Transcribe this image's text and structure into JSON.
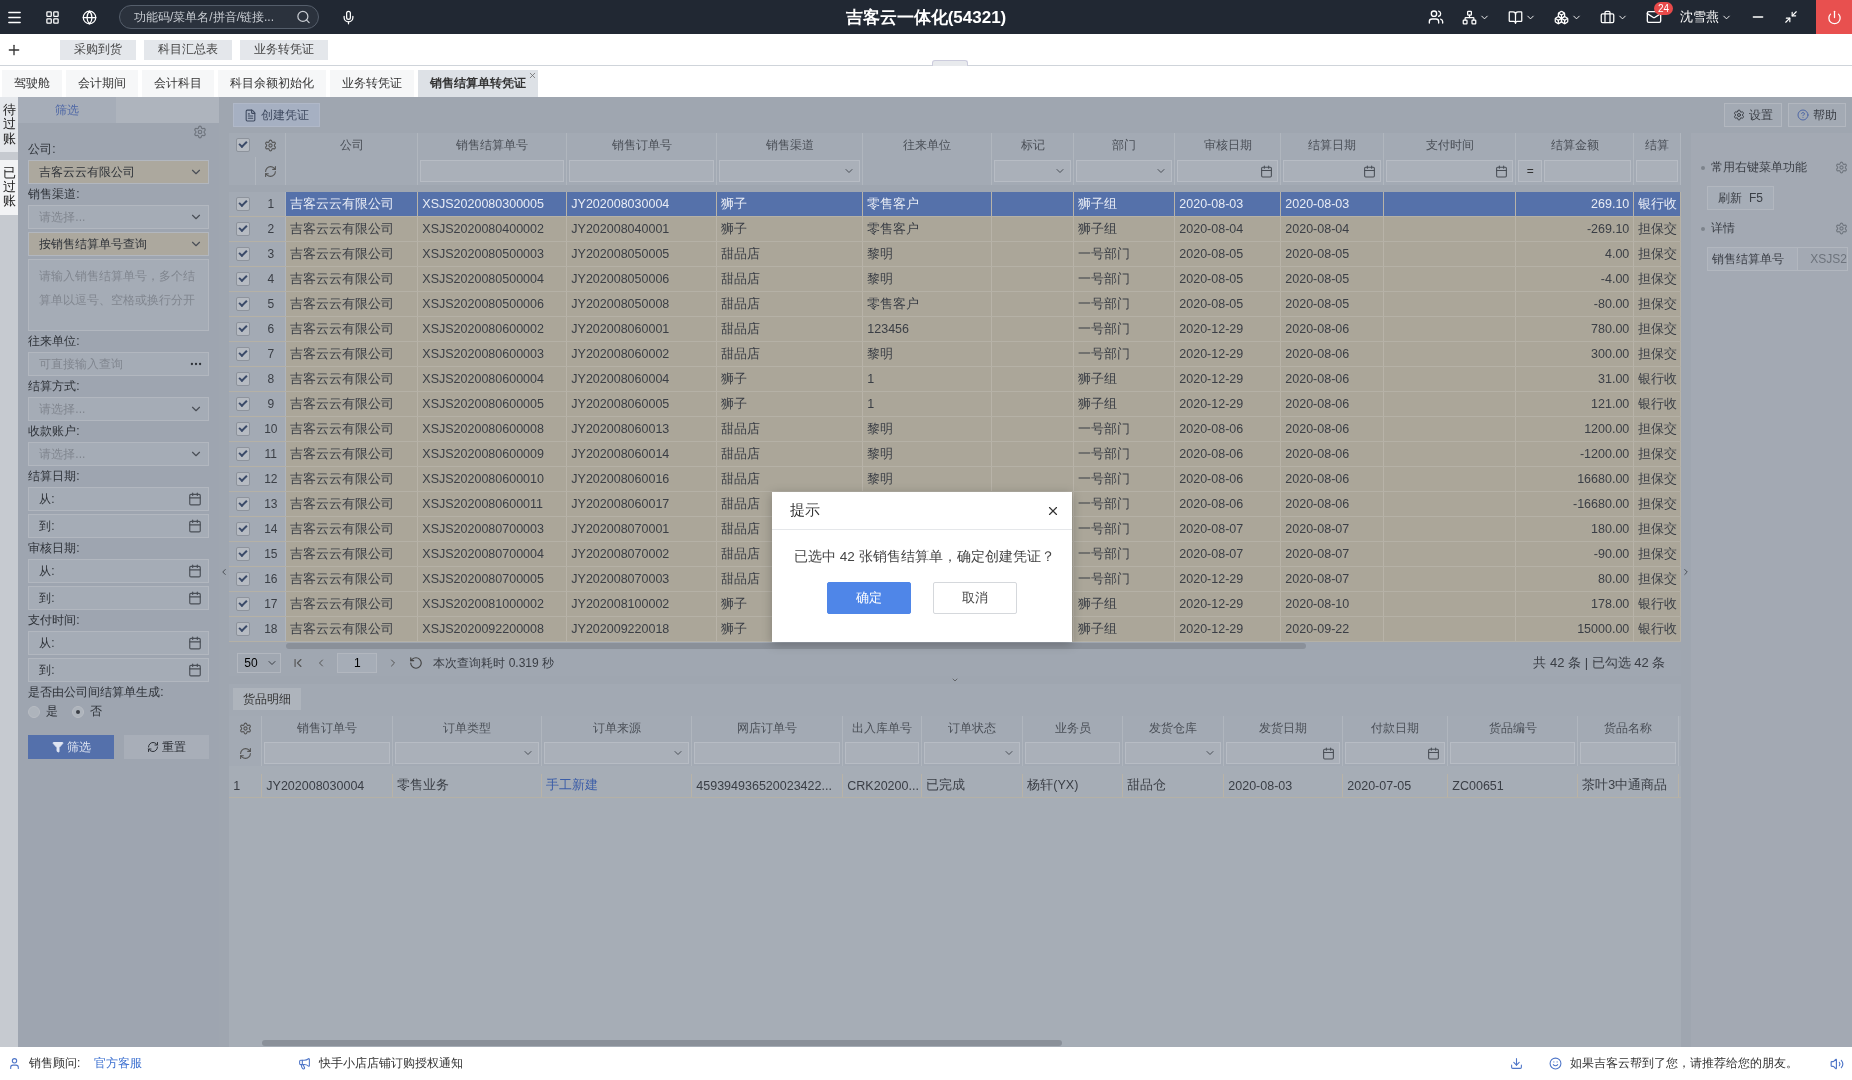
{
  "top_bar": {
    "search": {
      "placeholder": "功能码/菜单名/拼音/链接..."
    },
    "title": "吉客云一体化(54321)",
    "mail_badge": "24",
    "user": "沈雪燕"
  },
  "quick_bar": {
    "chips": [
      "采购到货",
      "科目汇总表",
      "业务转凭证"
    ]
  },
  "tabs": [
    {
      "label": "驾驶舱",
      "selected": false
    },
    {
      "label": "会计期间",
      "selected": false
    },
    {
      "label": "会计科目",
      "selected": false
    },
    {
      "label": "科目余额初始化",
      "selected": false
    },
    {
      "label": "业务转凭证",
      "selected": false
    },
    {
      "label": "销售结算单转凭证",
      "selected": true
    }
  ],
  "side_tabs": [
    {
      "label": "待过账",
      "selected": true
    },
    {
      "label": "已过账",
      "selected": false
    }
  ],
  "filter_panel": {
    "tabs": [
      {
        "label": "筛选",
        "selected": true
      }
    ],
    "fields": [
      {
        "kind": "select",
        "label": "公司:",
        "value": "吉客云云有限公司"
      },
      {
        "kind": "select",
        "label": "销售渠道:",
        "placeholder": "请选择..."
      },
      {
        "kind": "select",
        "value": "按销售结算单号查询"
      },
      {
        "kind": "textarea",
        "placeholder": "请输入销售结算单号，多个结算单以逗号、空格或换行分开"
      },
      {
        "kind": "lookup",
        "label": "往来单位:",
        "placeholder": "可直接输入查询"
      },
      {
        "kind": "select",
        "label": "结算方式:",
        "placeholder": "请选择..."
      },
      {
        "kind": "select",
        "label": "收款账户:",
        "placeholder": "请选择..."
      },
      {
        "kind": "date_range",
        "label": "结算日期:",
        "from": "从:",
        "to": "到:"
      },
      {
        "kind": "date_range",
        "label": "审核日期:",
        "from": "从:",
        "to": "到:"
      },
      {
        "kind": "date_range",
        "label": "支付时间:",
        "from": "从:",
        "to": "到:"
      },
      {
        "kind": "radio",
        "label": "是否由公司间结算单生成:",
        "options": [
          {
            "label": "是",
            "selected": false
          },
          {
            "label": "否",
            "selected": true
          }
        ]
      }
    ],
    "buttons": [
      {
        "label": "筛选",
        "kind": "primary"
      },
      {
        "label": "重置",
        "kind": "secondary"
      }
    ]
  },
  "toolbar": {
    "create_button": "创建凭证",
    "settings": "设置",
    "help": "帮助"
  },
  "table": {
    "header_checked": true,
    "columns": [
      {
        "label": "公司",
        "kind": "plain"
      },
      {
        "label": "销售结算单号",
        "kind": "text"
      },
      {
        "label": "销售订单号",
        "kind": "text"
      },
      {
        "label": "销售渠道",
        "kind": "select"
      },
      {
        "label": "往来单位",
        "kind": "plain"
      },
      {
        "label": "标记",
        "kind": "select"
      },
      {
        "label": "部门",
        "kind": "select"
      },
      {
        "label": "审核日期",
        "kind": "date"
      },
      {
        "label": "结算日期",
        "kind": "date"
      },
      {
        "label": "支付时间",
        "kind": "date"
      },
      {
        "label": "结算金额",
        "kind": "equals",
        "operator": "="
      },
      {
        "label": "结算",
        "kind": "text"
      }
    ],
    "rows": [
      {
        "no": "1",
        "checked": true,
        "selected": true,
        "cells": [
          "吉客云云有限公司",
          "XSJS2020080300005",
          "JY202008030004",
          "狮子",
          "零售客户",
          null,
          "狮子组",
          "2020-08-03",
          "2020-08-03",
          null,
          "269.10",
          "银行收"
        ]
      },
      {
        "no": "2",
        "checked": true,
        "selected": false,
        "cells": [
          "吉客云云有限公司",
          "XSJS2020080400002",
          "JY202008040001",
          "狮子",
          "零售客户",
          null,
          "狮子组",
          "2020-08-04",
          "2020-08-04",
          null,
          "-269.10",
          "担保交"
        ]
      },
      {
        "no": "3",
        "checked": true,
        "selected": false,
        "cells": [
          "吉客云云有限公司",
          "XSJS2020080500003",
          "JY202008050005",
          "甜品店",
          "黎明",
          null,
          "一号部门",
          "2020-08-05",
          "2020-08-05",
          null,
          "4.00",
          "担保交"
        ]
      },
      {
        "no": "4",
        "checked": true,
        "selected": false,
        "cells": [
          "吉客云云有限公司",
          "XSJS2020080500004",
          "JY202008050006",
          "甜品店",
          "黎明",
          null,
          "一号部门",
          "2020-08-05",
          "2020-08-05",
          null,
          "-4.00",
          "担保交"
        ]
      },
      {
        "no": "5",
        "checked": true,
        "selected": false,
        "cells": [
          "吉客云云有限公司",
          "XSJS2020080500006",
          "JY202008050008",
          "甜品店",
          "零售客户",
          null,
          "一号部门",
          "2020-08-05",
          "2020-08-05",
          null,
          "-80.00",
          "担保交"
        ]
      },
      {
        "no": "6",
        "checked": true,
        "selected": false,
        "cells": [
          "吉客云云有限公司",
          "XSJS2020080600002",
          "JY202008060001",
          "甜品店",
          "123456",
          null,
          "一号部门",
          "2020-12-29",
          "2020-08-06",
          null,
          "780.00",
          "担保交"
        ]
      },
      {
        "no": "7",
        "checked": true,
        "selected": false,
        "cells": [
          "吉客云云有限公司",
          "XSJS2020080600003",
          "JY202008060002",
          "甜品店",
          "黎明",
          null,
          "一号部门",
          "2020-12-29",
          "2020-08-06",
          null,
          "300.00",
          "担保交"
        ]
      },
      {
        "no": "8",
        "checked": true,
        "selected": false,
        "cells": [
          "吉客云云有限公司",
          "XSJS2020080600004",
          "JY202008060004",
          "狮子",
          "1",
          null,
          "狮子组",
          "2020-12-29",
          "2020-08-06",
          null,
          "31.00",
          "银行收"
        ]
      },
      {
        "no": "9",
        "checked": true,
        "selected": false,
        "cells": [
          "吉客云云有限公司",
          "XSJS2020080600005",
          "JY202008060005",
          "狮子",
          "1",
          null,
          "狮子组",
          "2020-12-29",
          "2020-08-06",
          null,
          "121.00",
          "银行收"
        ]
      },
      {
        "no": "10",
        "checked": true,
        "selected": false,
        "cells": [
          "吉客云云有限公司",
          "XSJS2020080600008",
          "JY202008060013",
          "甜品店",
          "黎明",
          null,
          "一号部门",
          "2020-08-06",
          "2020-08-06",
          null,
          "1200.00",
          "担保交"
        ]
      },
      {
        "no": "11",
        "checked": true,
        "selected": false,
        "cells": [
          "吉客云云有限公司",
          "XSJS2020080600009",
          "JY202008060014",
          "甜品店",
          "黎明",
          null,
          "一号部门",
          "2020-08-06",
          "2020-08-06",
          null,
          "-1200.00",
          "担保交"
        ]
      },
      {
        "no": "12",
        "checked": true,
        "selected": false,
        "cells": [
          "吉客云云有限公司",
          "XSJS2020080600010",
          "JY202008060016",
          "甜品店",
          "黎明",
          null,
          "一号部门",
          "2020-08-06",
          "2020-08-06",
          null,
          "16680.00",
          "担保交"
        ]
      },
      {
        "no": "13",
        "checked": true,
        "selected": false,
        "cells": [
          "吉客云云有限公司",
          "XSJS2020080600011",
          "JY202008060017",
          "甜品店",
          null,
          null,
          "一号部门",
          "2020-08-06",
          "2020-08-06",
          null,
          "-16680.00",
          "担保交"
        ]
      },
      {
        "no": "14",
        "checked": true,
        "selected": false,
        "cells": [
          "吉客云云有限公司",
          "XSJS2020080700003",
          "JY202008070001",
          "甜品店",
          null,
          null,
          "一号部门",
          "2020-08-07",
          "2020-08-07",
          null,
          "180.00",
          "担保交"
        ]
      },
      {
        "no": "15",
        "checked": true,
        "selected": false,
        "cells": [
          "吉客云云有限公司",
          "XSJS2020080700004",
          "JY202008070002",
          "甜品店",
          null,
          null,
          "一号部门",
          "2020-08-07",
          "2020-08-07",
          null,
          "-90.00",
          "担保交"
        ]
      },
      {
        "no": "16",
        "checked": true,
        "selected": false,
        "cells": [
          "吉客云云有限公司",
          "XSJS2020080700005",
          "JY202008070003",
          "甜品店",
          null,
          null,
          "一号部门",
          "2020-12-29",
          "2020-08-07",
          null,
          "80.00",
          "担保交"
        ]
      },
      {
        "no": "17",
        "checked": true,
        "selected": false,
        "cells": [
          "吉客云云有限公司",
          "XSJS2020081000002",
          "JY202008100002",
          "狮子",
          null,
          null,
          "狮子组",
          "2020-12-29",
          "2020-08-10",
          null,
          "178.00",
          "银行收"
        ]
      },
      {
        "no": "18",
        "checked": true,
        "selected": false,
        "cells": [
          "吉客云云有限公司",
          "XSJS2020092200008",
          "JY202009220018",
          "狮子",
          null,
          null,
          "狮子组",
          "2020-12-29",
          "2020-09-22",
          null,
          "15000.00",
          "银行收"
        ]
      }
    ]
  },
  "pager": {
    "page_size": "50",
    "page": "1",
    "query_time": "本次查询耗时 0.319 秒",
    "summary": "共 42 条 | 已勾选 42 条"
  },
  "right_panel": {
    "sections": [
      {
        "title": "常用右键菜单功能",
        "button": "刷新  F5"
      },
      {
        "title": "详情",
        "detail_label": "销售结算单号",
        "detail_value": "XSJS2"
      }
    ]
  },
  "detail": {
    "tab": "货品明细",
    "columns": [
      {
        "label": "销售订单号",
        "kind": "text"
      },
      {
        "label": "订单类型",
        "kind": "select"
      },
      {
        "label": "订单来源",
        "kind": "select"
      },
      {
        "label": "网店订单号",
        "kind": "text"
      },
      {
        "label": "出入库单号",
        "kind": "text"
      },
      {
        "label": "订单状态",
        "kind": "select"
      },
      {
        "label": "业务员",
        "kind": "text"
      },
      {
        "label": "发货仓库",
        "kind": "select"
      },
      {
        "label": "发货日期",
        "kind": "date"
      },
      {
        "label": "付款日期",
        "kind": "date"
      },
      {
        "label": "货品编号",
        "kind": "text"
      },
      {
        "label": "货品名称",
        "kind": "text"
      }
    ],
    "rows": [
      {
        "no": "1",
        "cells": [
          "JY202008030004",
          "零售业务",
          {
            "text": "手工新建",
            "kind": "link"
          },
          "459394936520023422...",
          "CRK20200...",
          "已完成",
          "杨轩(YX)",
          "甜品仓",
          "2020-08-03",
          "2020-07-05",
          "ZC00651",
          "茶叶3中通商品"
        ]
      }
    ]
  },
  "dialog": {
    "title": "提示",
    "message": "已选中 42 张销售结算单，确定创建凭证？",
    "buttons": [
      {
        "label": "确定",
        "kind": "primary"
      },
      {
        "label": "取消",
        "kind": "default"
      }
    ]
  },
  "status_bar": {
    "advisor_label": "销售顾问:",
    "advisor_link": "官方客服",
    "notice": "快手小店店铺订购授权通知",
    "feedback": "如果吉客云帮到了您，请推荐给您的朋友。"
  }
}
